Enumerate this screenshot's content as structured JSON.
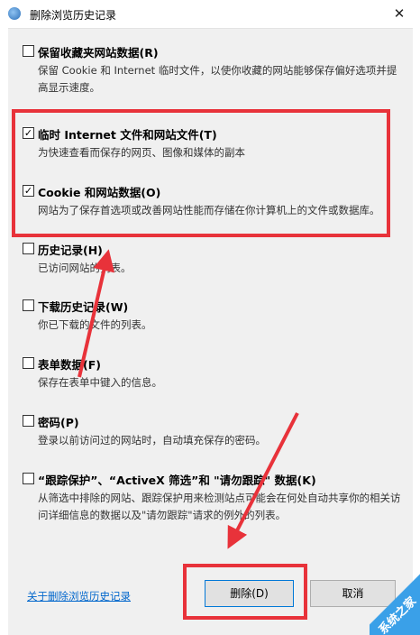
{
  "window": {
    "title": "删除浏览历史记录",
    "close_glyph": "✕"
  },
  "options": [
    {
      "title": "保留收藏夹网站数据(R)",
      "desc": "保留 Cookie 和 Internet 临时文件，以使你收藏的网站能够保存偏好选项并提高显示速度。",
      "checked": false
    },
    {
      "title": "临时 Internet 文件和网站文件(T)",
      "desc": "为快速查看而保存的网页、图像和媒体的副本",
      "checked": true
    },
    {
      "title": "Cookie 和网站数据(O)",
      "desc": "网站为了保存首选项或改善网站性能而存储在你计算机上的文件或数据库。",
      "checked": true
    },
    {
      "title": "历史记录(H)",
      "desc": "已访问网站的列表。",
      "checked": false
    },
    {
      "title": "下载历史记录(W)",
      "desc": "你已下载的文件的列表。",
      "checked": false
    },
    {
      "title": "表单数据(F)",
      "desc": "保存在表单中键入的信息。",
      "checked": false
    },
    {
      "title": "密码(P)",
      "desc": "登录以前访问过的网站时，自动填充保存的密码。",
      "checked": false
    },
    {
      "title": "“跟踪保护”、“ActiveX 筛选”和 \"请勿跟踪\" 数据(K)",
      "desc": "从筛选中排除的网站、跟踪保护用来检测站点可能会在何处自动共享你的相关访问详细信息的数据以及\"请勿跟踪\"请求的例外的列表。",
      "checked": false
    }
  ],
  "footer": {
    "about_link": "关于删除浏览历史记录",
    "delete_button": "删除(D)",
    "cancel_button": "取消"
  },
  "check_glyph": "✓",
  "watermark": "系统之家",
  "colors": {
    "highlight": "#e8323a",
    "link": "#0066cc",
    "default_button_border": "#0078d7"
  }
}
